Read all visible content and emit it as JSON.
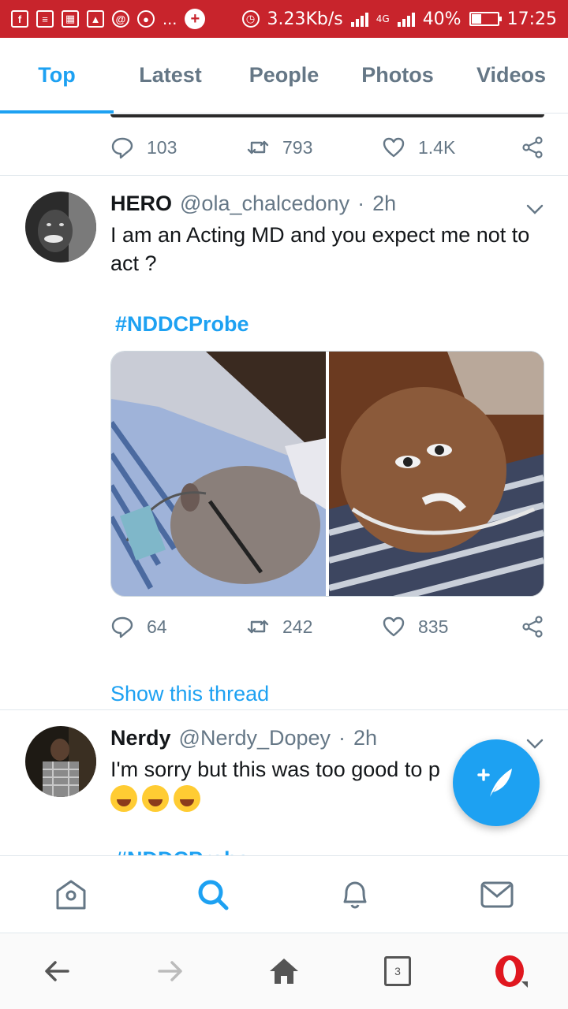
{
  "status_bar": {
    "speed": "3.23Kb/s",
    "network": "4G",
    "battery": "40%",
    "battery_level": 0.4,
    "time": "17:25",
    "dots": "..."
  },
  "tabs": [
    {
      "label": "Top",
      "active": true
    },
    {
      "label": "Latest",
      "active": false
    },
    {
      "label": "People",
      "active": false
    },
    {
      "label": "Photos",
      "active": false
    },
    {
      "label": "Videos",
      "active": false
    }
  ],
  "prev_tweet": {
    "replies": "103",
    "retweets": "793",
    "likes": "1.4K"
  },
  "tweet1": {
    "name": "HERO",
    "handle": "@ola_chalcedony",
    "sep": "·",
    "time": "2h",
    "text": "I am an Acting MD and you expect me not to act ?",
    "hashtag": "#NDDCProbe",
    "replies": "64",
    "retweets": "242",
    "likes": "835",
    "show_thread": "Show this thread"
  },
  "tweet2": {
    "name": "Nerdy",
    "handle": "@Nerdy_Dopey",
    "sep": "·",
    "time": "2h",
    "text": "I'm sorry but this was too good to p",
    "hashtag": "#NDDCProbe"
  },
  "browser": {
    "tab_count": "3"
  },
  "colors": {
    "accent": "#1da1f2",
    "status_bar": "#c8242c",
    "secondary_text": "#657786"
  }
}
